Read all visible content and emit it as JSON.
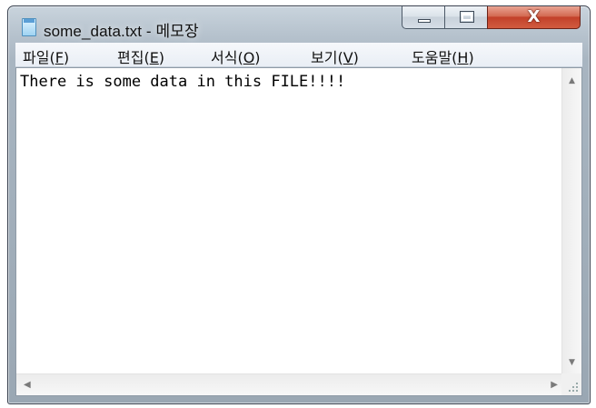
{
  "window": {
    "title": "some_data.txt - 메모장",
    "app_icon": "notepad-icon"
  },
  "caption_buttons": {
    "minimize_icon": "minimize-icon",
    "maximize_icon": "maximize-icon",
    "close_icon": "close-icon",
    "close_glyph": "X"
  },
  "menu": {
    "items": [
      {
        "prefix": "파일(",
        "accel": "F",
        "suffix": ")"
      },
      {
        "prefix": "편집(",
        "accel": "E",
        "suffix": ")"
      },
      {
        "prefix": "서식(",
        "accel": "O",
        "suffix": ")"
      },
      {
        "prefix": "보기(",
        "accel": "V",
        "suffix": ")"
      },
      {
        "prefix": "도움말(",
        "accel": "H",
        "suffix": ")"
      }
    ]
  },
  "editor": {
    "content": "There is some data in this FILE!!!!"
  },
  "scrollbars": {
    "up_arrow": "▲",
    "down_arrow": "▼",
    "left_arrow": "◀",
    "right_arrow": "▶"
  }
}
